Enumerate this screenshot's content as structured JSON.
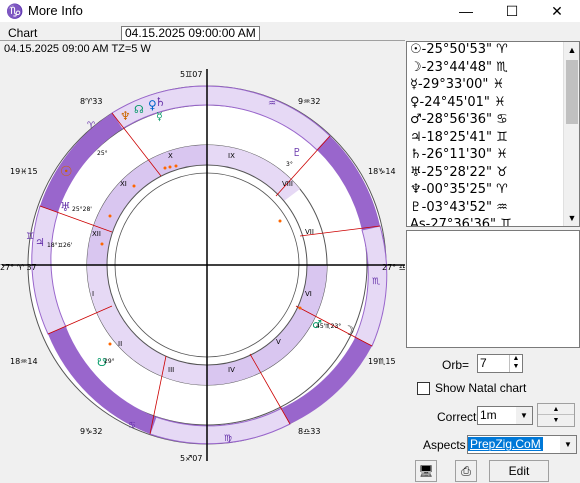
{
  "window": {
    "title": "More Info",
    "minimize": "—",
    "maximize": "☐",
    "close": "✕"
  },
  "tab": {
    "label": "Chart",
    "date": "04.15.2025  09:00:00 AM"
  },
  "chart_info": "04.15.2025  09:00 AM TZ=5 W",
  "cusps": {
    "top": "5♊07",
    "bottom": "5♐07",
    "left": "27° ♈ 37",
    "right": "27° ♎ 37",
    "h11": "8♈33",
    "h12": "19♓15",
    "h2": "18♒14",
    "h3": "9♑32",
    "h9": "9♒32",
    "h8": "18♑14",
    "h6": "19♏15",
    "h5": "8♎33"
  },
  "house_numbers": [
    "X",
    "IX",
    "VIII",
    "VII",
    "VI",
    "V",
    "IV",
    "III",
    "II",
    "I",
    "XII",
    "XI"
  ],
  "chart_planets": [
    {
      "glyph": "♆",
      "deg": "3°"
    },
    {
      "glyph": "☊",
      "deg": "29°"
    },
    {
      "glyph": "♀",
      "deg": "25°"
    },
    {
      "glyph": "☿",
      "deg": "5°"
    },
    {
      "glyph": "♄",
      "deg": "26°"
    },
    {
      "glyph": "☉",
      "deg": "25°"
    },
    {
      "glyph": "♅",
      "deg": "25°28'"
    },
    {
      "glyph": "♃",
      "deg": "18°♊26'"
    },
    {
      "glyph": "♇",
      "deg": "3°"
    },
    {
      "glyph": "♂",
      "deg": "45'♏23°"
    },
    {
      "glyph": "☽",
      "deg": "23°"
    },
    {
      "glyph": "☋",
      "deg": "29°"
    }
  ],
  "planet_list": [
    "☉-25°50'53\" ♈",
    "☽-23°44'48\" ♏",
    "☿-29°33'00\" ♓",
    "♀-24°45'01\" ♓",
    "♂-28°56'36\" ♋",
    "♃-18°25'41\" ♊",
    "♄-26°11'30\" ♓",
    "♅-25°28'22\" ♉",
    "♆-00°35'25\" ♈",
    "♇-03°43'52\" ♒",
    "As-27°36'36\" ♊"
  ],
  "controls": {
    "orb_label": "Orb=",
    "orb_value": "7",
    "show_natal_label": "Show Natal chart",
    "correct_label": "Correct",
    "correct_value": "1m",
    "aspects_label": "Aspects",
    "aspects_value": "PrepZig.CoM",
    "edit_label": "Edit"
  },
  "colors": {
    "ring_dark": "#9966cc",
    "ring_light": "#e6d9f5",
    "accent": "#0078d7"
  }
}
